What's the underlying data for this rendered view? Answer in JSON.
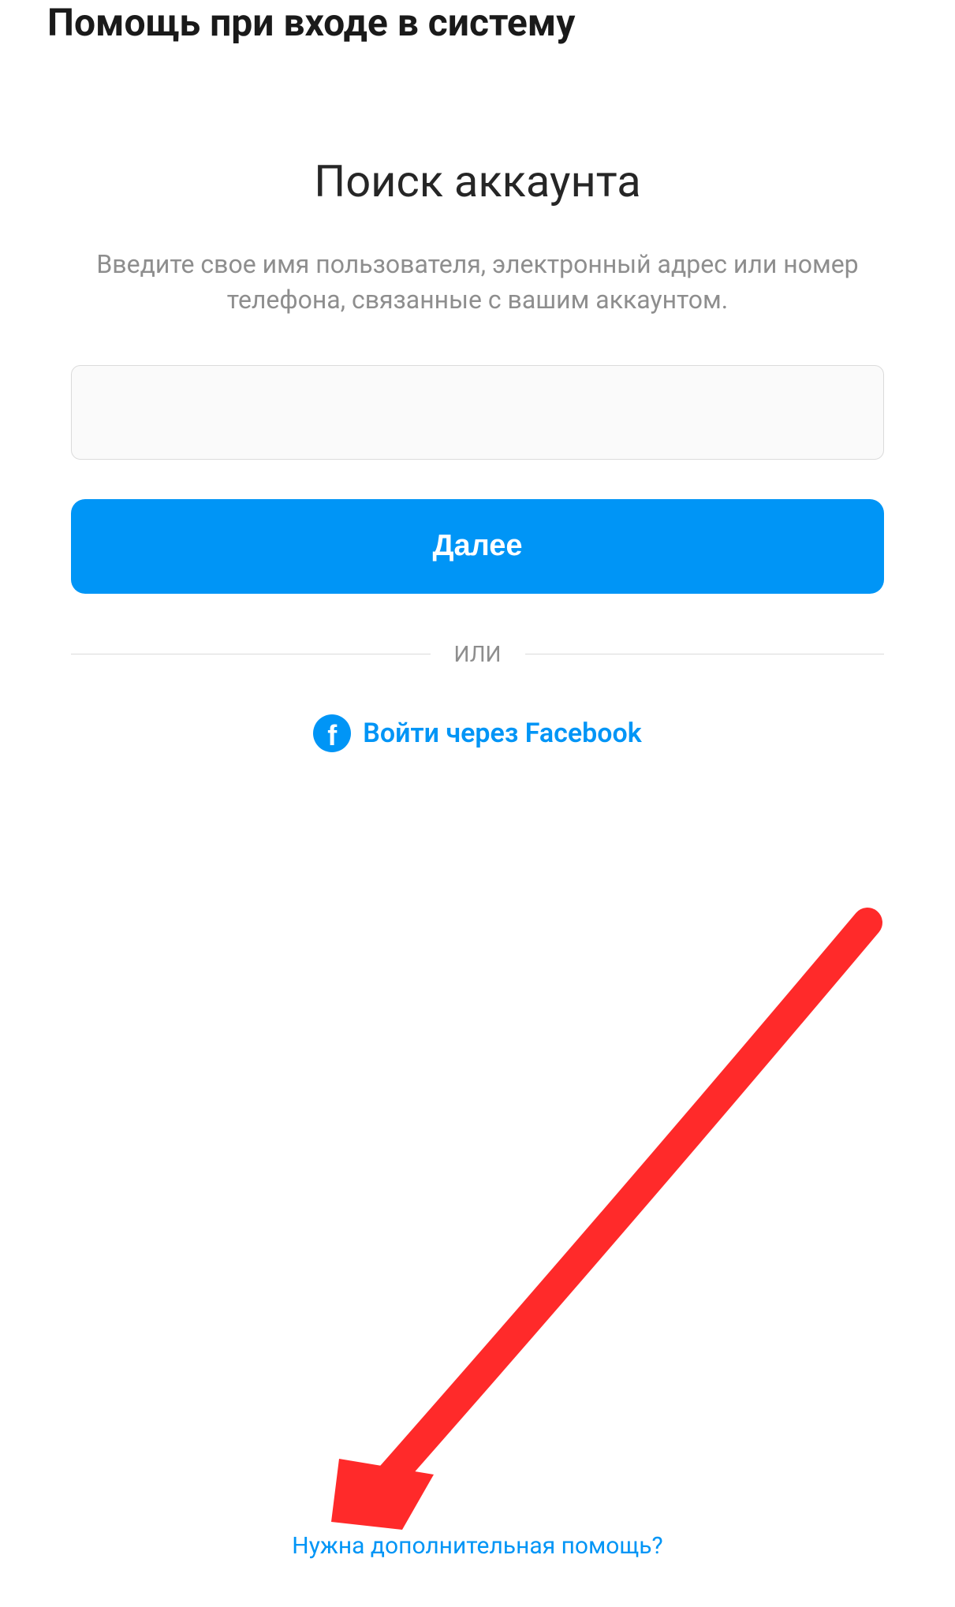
{
  "header": {
    "title": "Помощь при входе в систему"
  },
  "main": {
    "title": "Поиск аккаунта",
    "instructions": "Введите свое имя пользователя, электронный адрес или номер телефона, связанные с вашим аккаунтом.",
    "input_value": "",
    "next_button_label": "Далее",
    "divider_text": "ИЛИ",
    "facebook_login_label": "Войти через Facebook"
  },
  "footer": {
    "help_link_label": "Нужна дополнительная помощь?"
  },
  "annotation": {
    "type": "arrow",
    "color": "#ff2a2a",
    "target": "help-link"
  }
}
